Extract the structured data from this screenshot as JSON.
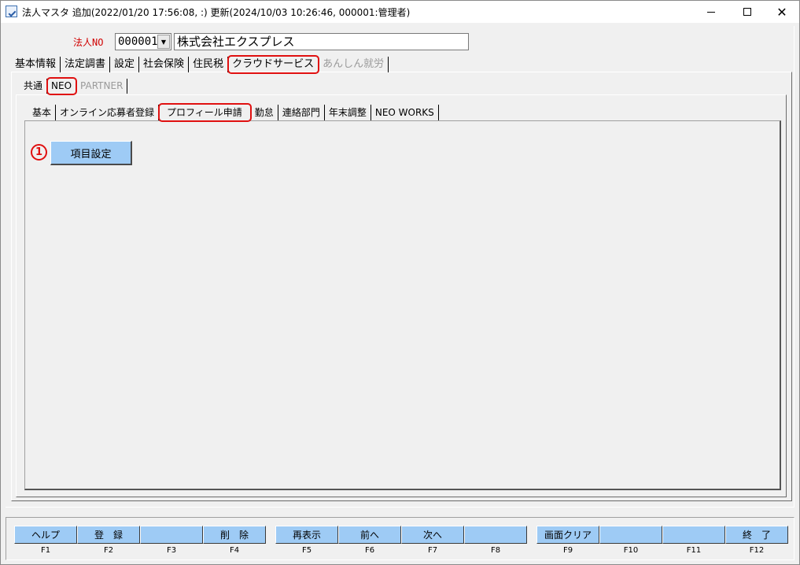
{
  "window": {
    "title": "法人マスタ  追加(2022/01/20 17:56:08, :)  更新(2024/10/03 10:26:46, 000001:管理者)"
  },
  "header": {
    "corp_label": "法人NO",
    "corp_no": "000001",
    "corp_name": "株式会社エクスプレス"
  },
  "tabs_main": [
    {
      "label": "基本情報"
    },
    {
      "label": "法定調書"
    },
    {
      "label": "設定"
    },
    {
      "label": "社会保険"
    },
    {
      "label": "住民税"
    },
    {
      "label": "クラウドサービス"
    },
    {
      "label": "あんしん就労"
    }
  ],
  "tabs_sub": [
    {
      "label": "共通"
    },
    {
      "label": "NEO"
    },
    {
      "label": "PARTNER"
    }
  ],
  "tabs_neo": [
    {
      "label": "基本"
    },
    {
      "label": "オンライン応募者登録"
    },
    {
      "label": "プロフィール申請"
    },
    {
      "label": "勤怠"
    },
    {
      "label": "連絡部門"
    },
    {
      "label": "年末調整"
    },
    {
      "label": "NEO WORKS"
    }
  ],
  "content": {
    "step_marker": "1",
    "item_settings_button": "項目設定"
  },
  "function_keys": [
    {
      "label": "ヘルプ",
      "key": "F1"
    },
    {
      "label": "登　録",
      "key": "F2"
    },
    {
      "label": "",
      "key": "F3"
    },
    {
      "label": "削　除",
      "key": "F4"
    },
    {
      "label": "再表示",
      "key": "F5"
    },
    {
      "label": "前へ",
      "key": "F6"
    },
    {
      "label": "次へ",
      "key": "F7"
    },
    {
      "label": "",
      "key": "F8"
    },
    {
      "label": "画面クリア",
      "key": "F9"
    },
    {
      "label": "",
      "key": "F10"
    },
    {
      "label": "",
      "key": "F11"
    },
    {
      "label": "終　了",
      "key": "F12"
    }
  ],
  "colors": {
    "button_blue": "#9ecbf5",
    "highlight_red": "#e01010",
    "label_red": "#d00000"
  }
}
